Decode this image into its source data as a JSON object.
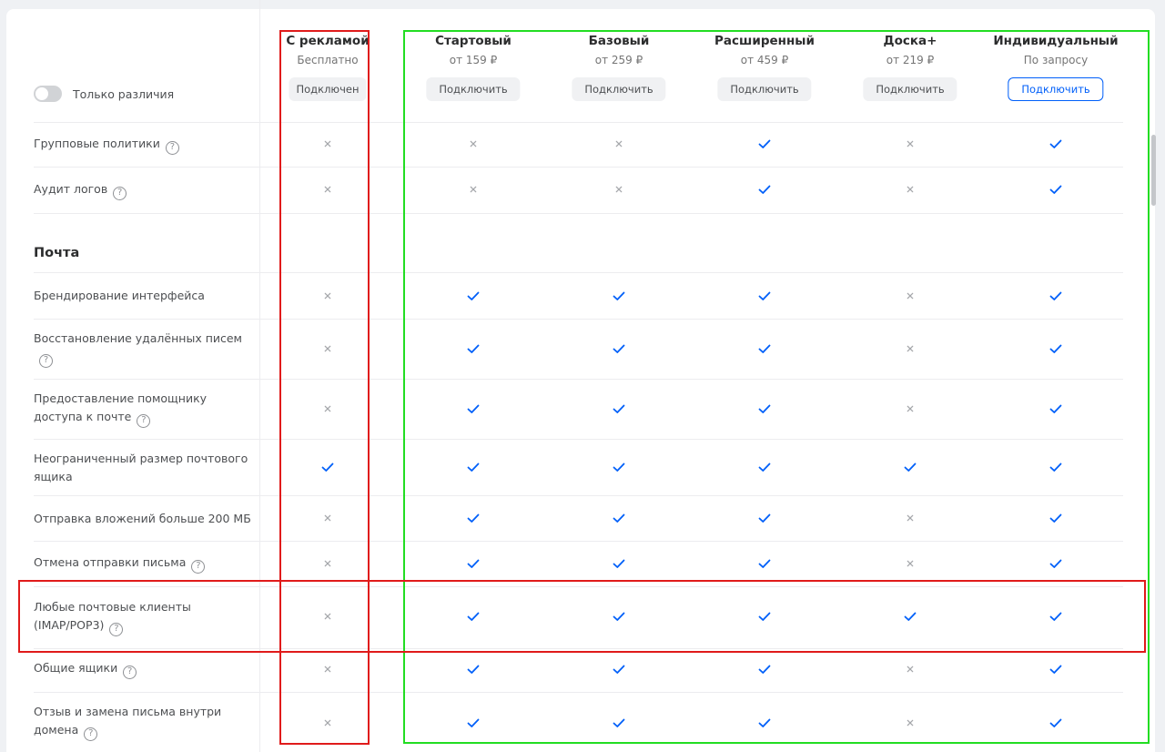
{
  "toggle": {
    "label": "Только различия",
    "enabled": false
  },
  "plans": [
    {
      "name": "С рекламой",
      "price": "Бесплатно",
      "button": "Подключен",
      "style": "current",
      "center": 360
    },
    {
      "name": "Стартовый",
      "price": "от 159 ₽",
      "button": "Подключить",
      "style": "secondary",
      "center": 520
    },
    {
      "name": "Базовый",
      "price": "от 259 ₽",
      "button": "Подключить",
      "style": "secondary",
      "center": 680
    },
    {
      "name": "Расширенный",
      "price": "от 459 ₽",
      "button": "Подключить",
      "style": "secondary",
      "center": 840
    },
    {
      "name": "Доска+",
      "price": "от 219 ₽",
      "button": "Подключить",
      "style": "secondary",
      "center": 1000
    },
    {
      "name": "Индивидуальный",
      "price": "По запросу",
      "button": "Подключить",
      "style": "primary",
      "center": 1160
    }
  ],
  "sections": [
    {
      "title": "",
      "features": [
        {
          "name": "Групповые политики",
          "help": true,
          "values": [
            false,
            false,
            false,
            true,
            false,
            true
          ]
        },
        {
          "name": "Аудит логов",
          "help": true,
          "values": [
            false,
            false,
            false,
            true,
            false,
            true
          ]
        }
      ]
    },
    {
      "title": "Почта",
      "features": [
        {
          "name": "Брендирование интерфейса",
          "help": false,
          "values": [
            false,
            true,
            true,
            true,
            false,
            true
          ]
        },
        {
          "name": "Восстановление удалённых писем",
          "help": true,
          "values": [
            false,
            true,
            true,
            true,
            false,
            true
          ]
        },
        {
          "name": "Предоставление помощнику доступа к почте",
          "help": true,
          "values": [
            false,
            true,
            true,
            true,
            false,
            true
          ]
        },
        {
          "name": "Неограниченный размер почтового ящика",
          "help": false,
          "values": [
            true,
            true,
            true,
            true,
            true,
            true
          ]
        },
        {
          "name": "Отправка вложений больше 200 МБ",
          "help": false,
          "values": [
            false,
            true,
            true,
            true,
            false,
            true
          ]
        },
        {
          "name": "Отмена отправки письма",
          "help": true,
          "values": [
            false,
            true,
            true,
            true,
            false,
            true
          ]
        },
        {
          "name": "Любые почтовые клиенты (IMAP/POP3)",
          "help": true,
          "values": [
            false,
            true,
            true,
            true,
            true,
            true
          ]
        },
        {
          "name": "Общие ящики",
          "help": true,
          "values": [
            false,
            true,
            true,
            true,
            false,
            true
          ]
        },
        {
          "name": "Отзыв и замена письма внутри домена",
          "help": true,
          "values": [
            false,
            true,
            true,
            true,
            false,
            true
          ]
        }
      ]
    }
  ],
  "help_glyph": "?",
  "icons": {
    "included": "check-icon",
    "excluded": "cross-icon",
    "help": "question-circle-icon"
  },
  "colors": {
    "check": "#005ff9",
    "cross": "#a5a7ab",
    "primary_button": "#005ff9",
    "highlight_red": "#e01b1b",
    "highlight_green": "#22dd22"
  }
}
